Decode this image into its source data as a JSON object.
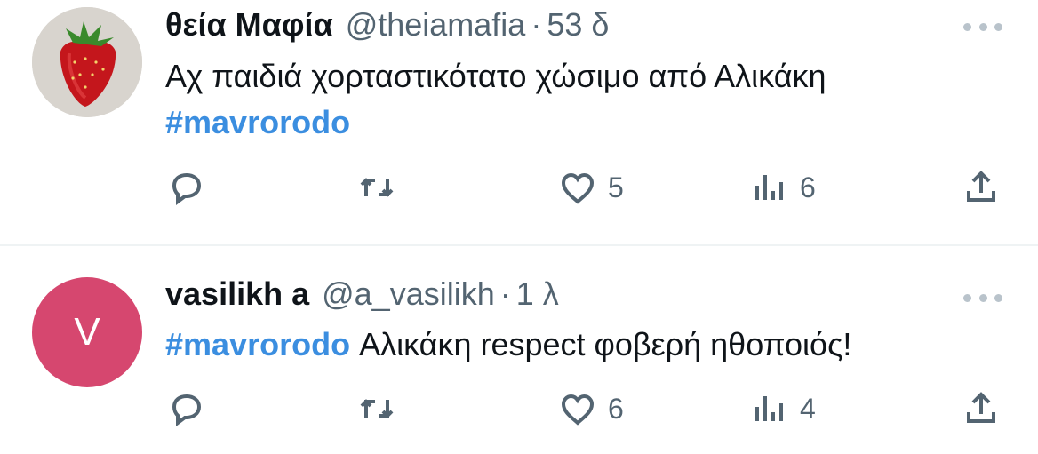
{
  "tweets": [
    {
      "name": "θεία Μαφία",
      "handle": "@theiamafia",
      "separator": "·",
      "time": "53 δ",
      "text_before": "Αχ παιδιά χορταστικότατο χώσιμο από Αλικάκη",
      "hashtag": "#mavrorodo",
      "text_after": "",
      "avatar": "strawberry-avatar",
      "likes": "5",
      "views": "6"
    },
    {
      "name": "vasilikh a",
      "handle": "@a_vasilikh",
      "separator": "·",
      "time": "1 λ",
      "avatar_letter": "V",
      "avatar_color": "#d6476f",
      "hashtag": "#mavrorodo",
      "text_after": " Αλικάκη respect φοβερή ηθοποιός!",
      "likes": "6",
      "views": "4"
    }
  ],
  "colors": {
    "hashtag": "#3b8ee0",
    "secondary_text": "#536471",
    "divider": "#eff3f4"
  },
  "icons": [
    "reply-icon",
    "retweet-icon",
    "like-icon",
    "views-icon",
    "share-icon",
    "more-icon"
  ]
}
